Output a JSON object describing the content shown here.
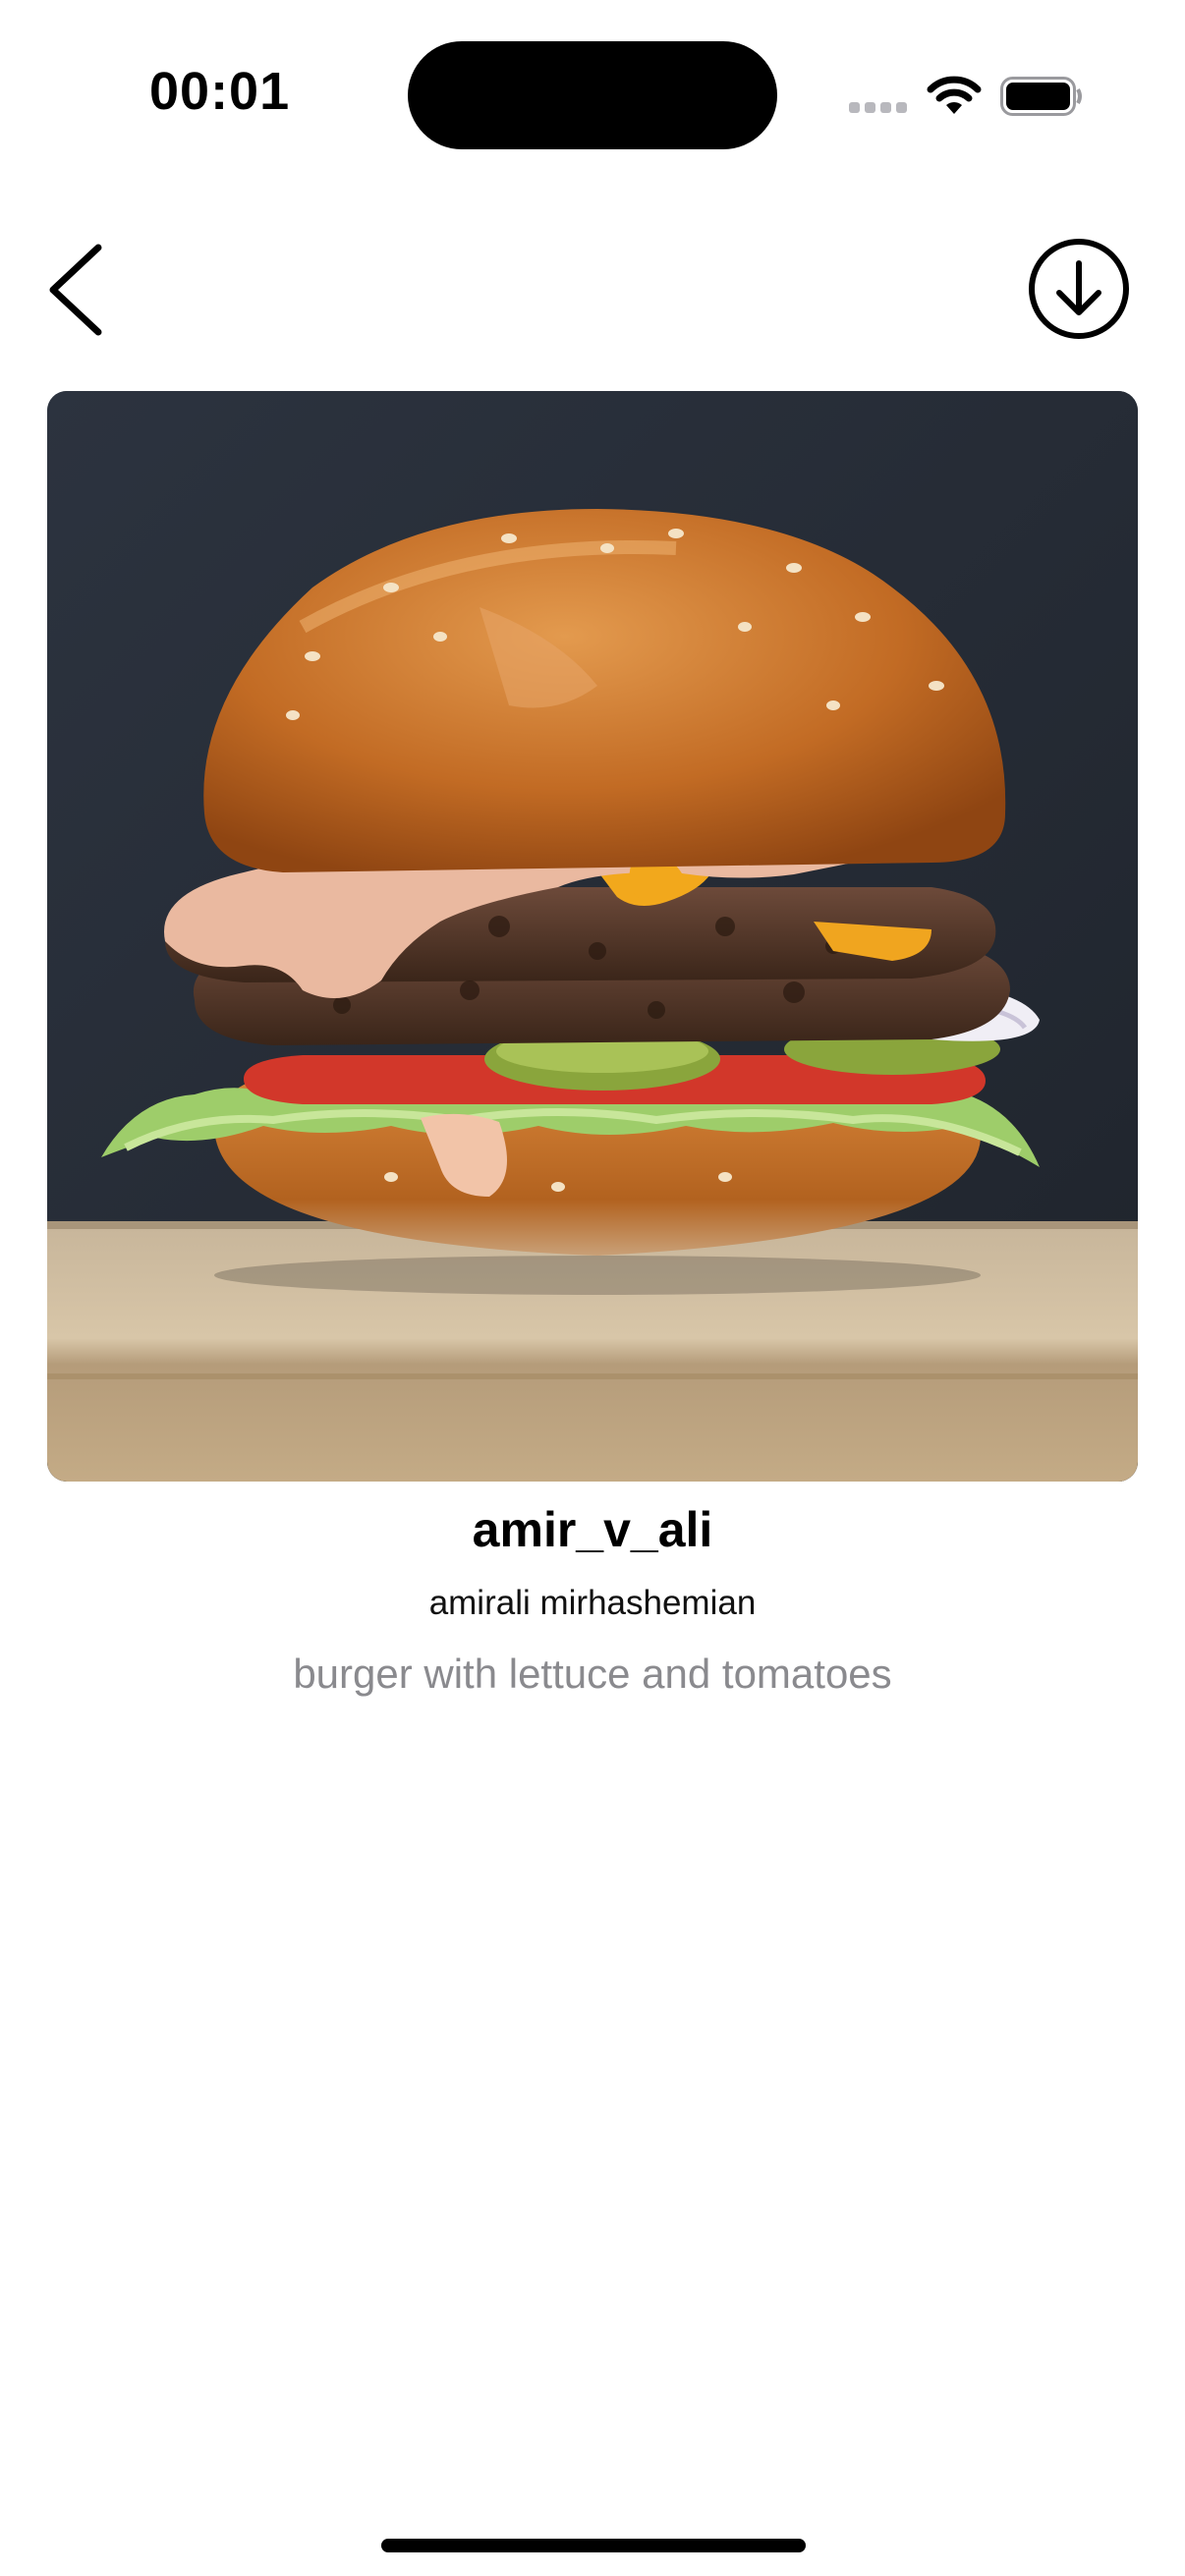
{
  "status_bar": {
    "time": "00:01"
  },
  "icons": {
    "back": "chevron-left-icon",
    "download": "download-circle-icon",
    "wifi": "wifi-icon",
    "battery": "battery-icon",
    "signal": "cellular-signal-icon"
  },
  "post": {
    "image_alt": "burger with lettuce and tomatoes",
    "username": "amir_v_ali",
    "full_name": "amirali mirhashemian",
    "description": "burger with lettuce and tomatoes"
  }
}
